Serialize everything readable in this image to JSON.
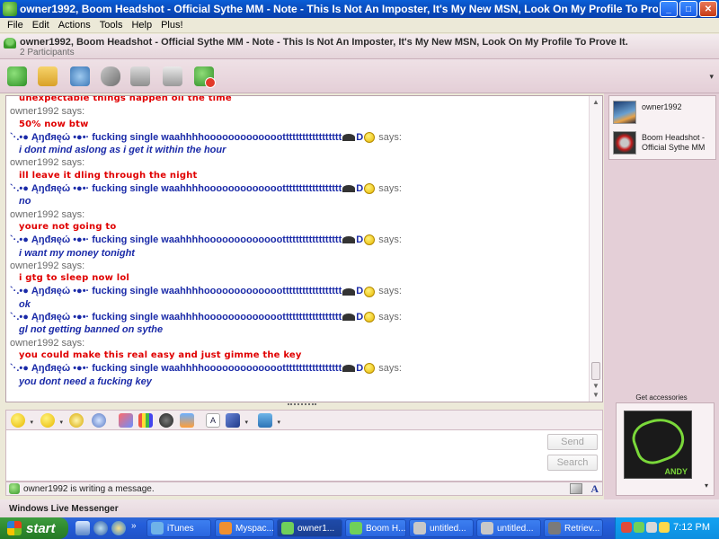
{
  "window": {
    "title": "owner1992, Boom Headshot - Official Sythe MM - Note - This Is Not An Imposter, It's My New MSN,  Look On My Profile To Prove It. - Conversation",
    "minimize": "_",
    "maximize": "□",
    "close": "✕"
  },
  "menu": [
    "File",
    "Edit",
    "Actions",
    "Tools",
    "Help",
    "Plus!"
  ],
  "header": {
    "names": "owner1992, Boom Headshot - Official Sythe MM - Note - This Is Not An Imposter, It's My New MSN,  Look On My Profile To Prove It.",
    "participants": "2 Participants"
  },
  "toolbar": {
    "icons": [
      "invite-icon",
      "share-files-icon",
      "video-call-icon",
      "call-icon",
      "activities-icon",
      "games-icon",
      "block-icon"
    ],
    "more": "▾"
  },
  "conversation": {
    "andrew_name": "`·.•● Ąŋđяęώ  •●•·  fucking single waahhhhoooooooooooootttttttttttttttttt",
    "andrew_suffix": "D",
    "says": " says:",
    "owner_says": "owner1992 says:",
    "lines": [
      {
        "kind": "owner_msg",
        "text": "unexpectable things happen oll the time"
      },
      {
        "kind": "owner_says"
      },
      {
        "kind": "owner_msg",
        "text": "50% now btw"
      },
      {
        "kind": "andrew_says"
      },
      {
        "kind": "andrew_msg",
        "text": "i dont mind aslong as i get it within the hour"
      },
      {
        "kind": "owner_says"
      },
      {
        "kind": "owner_msg",
        "text": "ill leave it dling through the night"
      },
      {
        "kind": "andrew_says"
      },
      {
        "kind": "andrew_msg",
        "text": "no"
      },
      {
        "kind": "owner_says"
      },
      {
        "kind": "owner_msg",
        "text": "youre not going to"
      },
      {
        "kind": "andrew_says"
      },
      {
        "kind": "andrew_msg",
        "text": "i want my money tonight"
      },
      {
        "kind": "owner_says"
      },
      {
        "kind": "owner_msg",
        "text": "i gtg to sleep now lol"
      },
      {
        "kind": "andrew_says"
      },
      {
        "kind": "andrew_msg",
        "text": "ok"
      },
      {
        "kind": "andrew_says"
      },
      {
        "kind": "andrew_msg",
        "text": "gl not getting banned on sythe"
      },
      {
        "kind": "owner_says"
      },
      {
        "kind": "owner_msg",
        "text": "you could make this real easy and just gimme the key"
      },
      {
        "kind": "andrew_says"
      },
      {
        "kind": "andrew_msg",
        "text": "you dont need a fucking key"
      }
    ]
  },
  "input": {
    "send_label": "Send",
    "search_label": "Search",
    "status_text": "owner1992 is writing a message.",
    "type_label": "A"
  },
  "brand": "Windows Live Messenger",
  "contacts": [
    {
      "name": "owner1992"
    },
    {
      "name": "Boom Headshot - Official Sythe MM"
    }
  ],
  "accessories": {
    "label": "Get accessories",
    "image_label": "ANDY",
    "more": "▾"
  },
  "taskbar": {
    "start_label": "start",
    "quicklaunch_more": "»",
    "tasks": [
      {
        "label": "iTunes",
        "color": "#6fb3e8"
      },
      {
        "label": "Myspac...",
        "color": "#f09030"
      },
      {
        "label": "owner1...",
        "color": "#6fd05a"
      },
      {
        "label": "Boom H...",
        "color": "#6fd05a"
      },
      {
        "label": "untitled...",
        "color": "#c8c8c8"
      },
      {
        "label": "untitled...",
        "color": "#c8c8c8"
      },
      {
        "label": "Retriev...",
        "color": "#7a7a7a"
      }
    ],
    "clock": "7:12 PM"
  },
  "colors": {
    "owner_message": "#e00000",
    "andrew_message": "#1a2aa8",
    "says_gray": "#6b6b6b"
  }
}
